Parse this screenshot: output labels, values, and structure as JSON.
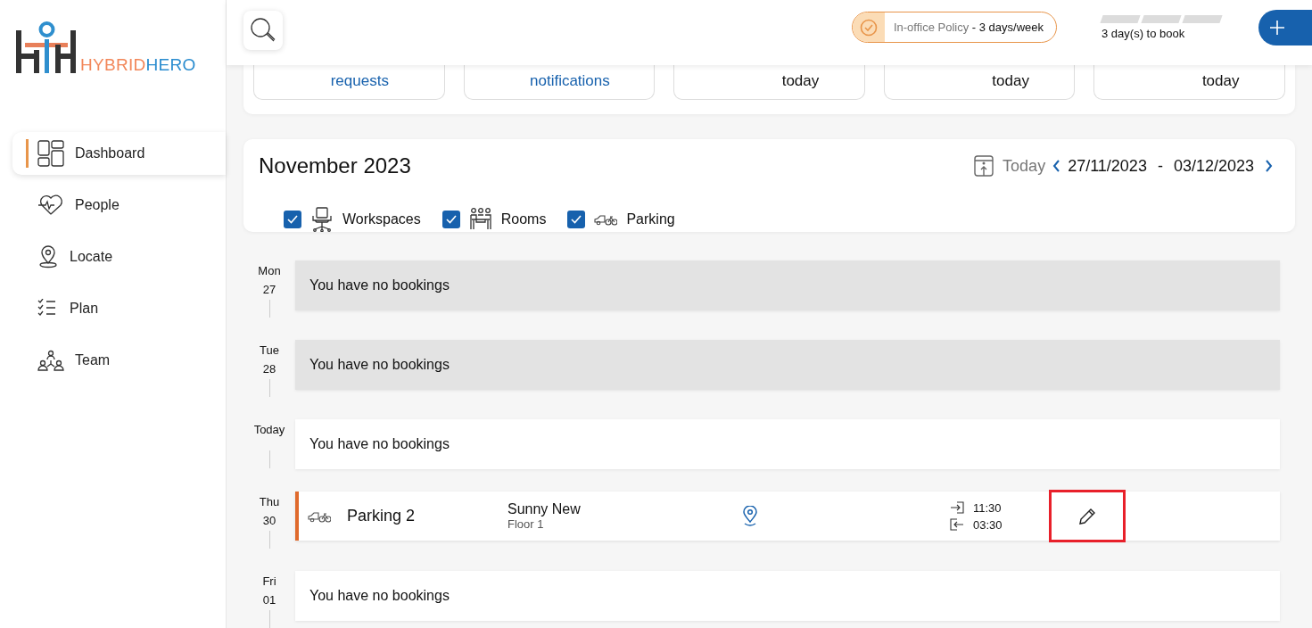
{
  "logo": {
    "part_1": "HYBRID",
    "part_2": "HERO"
  },
  "sidebar": {
    "items": [
      {
        "label": "Dashboard",
        "selected": true
      },
      {
        "label": "People",
        "selected": false
      },
      {
        "label": "Locate",
        "selected": false
      },
      {
        "label": "Plan",
        "selected": false
      },
      {
        "label": "Team",
        "selected": false
      }
    ]
  },
  "header": {
    "policy": "In-office Policy **- 3 days/week**",
    "days_to_book": "3 day(s) to book",
    "segments": [
      {
        "filled": false
      },
      {
        "filled": false
      },
      {
        "filled": false
      }
    ]
  },
  "stats": [
    {
      "text": "requests",
      "kind": "link"
    },
    {
      "text": "notifications",
      "kind": "link"
    },
    {
      "text": "today",
      "kind": "plain"
    },
    {
      "text": "today",
      "kind": "plain"
    },
    {
      "text": "today",
      "kind": "plain"
    }
  ],
  "calendar": {
    "title": "November 2023",
    "today_button": "Today",
    "range_start": "27/11/2023",
    "separator": "-",
    "range_end": "03/12/2023",
    "filters": [
      {
        "label": "Workspaces",
        "kind": "workspace",
        "checked": true
      },
      {
        "label": "Rooms",
        "kind": "room",
        "checked": true
      },
      {
        "label": "Parking",
        "kind": "parking",
        "checked": true
      }
    ]
  },
  "days": [
    {
      "weekday": "Mon",
      "date": "27",
      "past": true,
      "kind": "empty",
      "text": "You have no bookings"
    },
    {
      "weekday": "Tue",
      "date": "28",
      "past": true,
      "kind": "empty",
      "text": "You have no bookings"
    },
    {
      "weekday": "Today",
      "past": false,
      "kind": "empty",
      "text": "You have no bookings"
    },
    {
      "weekday": "Thu",
      "date": "30",
      "kind": "booking",
      "color": "#e06a2c",
      "title": "Parking 2",
      "location": "Sunny New",
      "floor": "Floor 1",
      "check_in": "11:30",
      "check_out": "03:30",
      "edit_highlighted": true
    },
    {
      "weekday": "Fri",
      "date": "01",
      "past": false,
      "kind": "empty",
      "text": "You have no bookings"
    }
  ]
}
